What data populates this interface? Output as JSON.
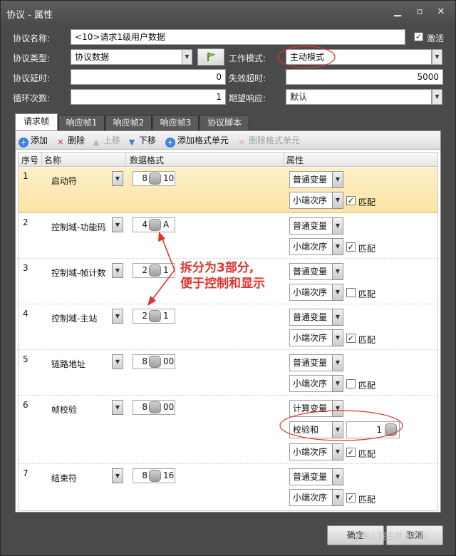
{
  "window": {
    "title": "协议 - 属性",
    "controls": [
      "minimize-icon",
      "maximize-icon",
      "close-icon"
    ]
  },
  "form": {
    "name_label": "协议名称:",
    "name_value": "<10>请求1级用户数据",
    "enabled_label": "激活",
    "enabled_checked": true,
    "type_label": "协议类型:",
    "type_value": "协议数据",
    "work_mode_label": "工作模式:",
    "work_mode_value": "主动模式",
    "delay_label": "协议延时:",
    "delay_value": "0",
    "timeout_label": "失效超时:",
    "timeout_value": "5000",
    "loop_label": "循环次数:",
    "loop_value": "1",
    "expect_label": "期望响应:",
    "expect_value": "默认"
  },
  "tabs": [
    "请求帧",
    "响应帧1",
    "响应帧2",
    "响应帧3",
    "协议脚本"
  ],
  "active_tab": 0,
  "toolbar": {
    "add": "添加",
    "delete": "删除",
    "move_up": "上移",
    "move_down": "下移",
    "add_format_unit": "添加格式单元",
    "delete_format_unit": "删除格式单元"
  },
  "columns": {
    "index": "序号",
    "name": "名称",
    "format": "数据格式",
    "props": "属性"
  },
  "rows": [
    {
      "index": "1",
      "name": "启动符",
      "fmt_a": "8",
      "fmt_b": "10",
      "var": "普通变量",
      "order": "小端次序",
      "match_label": "匹配",
      "match": true,
      "selected": true
    },
    {
      "index": "2",
      "name": "控制域-功能码",
      "fmt_a": "4",
      "fmt_b": "A",
      "var": "普通变量",
      "order": "小端次序",
      "match_label": "匹配",
      "match": true
    },
    {
      "index": "3",
      "name": "控制域-帧计数",
      "fmt_a": "2",
      "fmt_b": "1",
      "var": "普通变量",
      "order": "小端次序",
      "match_label": "匹配",
      "match": false
    },
    {
      "index": "4",
      "name": "控制域-主站",
      "fmt_a": "2",
      "fmt_b": "1",
      "var": "普通变量",
      "order": "小端次序",
      "match_label": "匹配",
      "match": true
    },
    {
      "index": "5",
      "name": "链路地址",
      "fmt_a": "8",
      "fmt_b": "00",
      "var": "普通变量",
      "order": "小端次序",
      "match_label": "匹配",
      "match": false
    },
    {
      "index": "6",
      "name": "帧校验",
      "fmt_a": "8",
      "fmt_b": "00",
      "var": "计算变量",
      "calc": "校验和",
      "calc_value": "1",
      "order": "小端次序",
      "match_label": "匹配",
      "match": true
    },
    {
      "index": "7",
      "name": "结束符",
      "fmt_a": "8",
      "fmt_b": "16",
      "var": "普通变量",
      "order": "小端次序",
      "match_label": "匹配",
      "match": true
    }
  ],
  "annotation": {
    "line1": "拆分为3部分,",
    "line2": "便于控制和显示",
    "color": "#e0342d"
  },
  "buttons": {
    "ok": "确定",
    "cancel": "取消"
  },
  "watermark": "@稀土掘金技术社区"
}
